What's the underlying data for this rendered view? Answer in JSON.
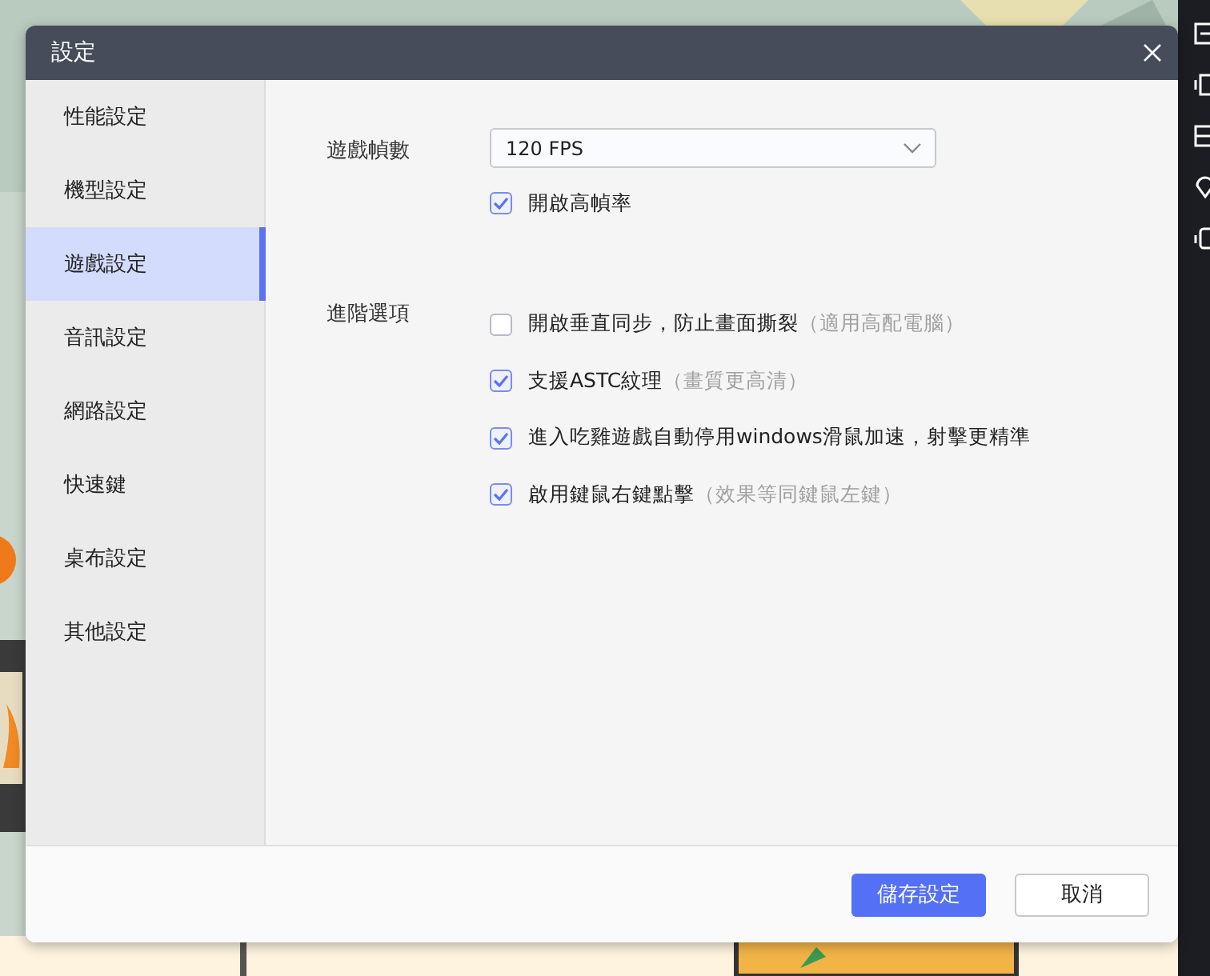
{
  "dialog": {
    "title": "設定"
  },
  "sidebar": {
    "items": [
      {
        "label": "性能設定",
        "selected": false
      },
      {
        "label": "機型設定",
        "selected": false
      },
      {
        "label": "遊戲設定",
        "selected": true
      },
      {
        "label": "音訊設定",
        "selected": false
      },
      {
        "label": "網路設定",
        "selected": false
      },
      {
        "label": "快速鍵",
        "selected": false
      },
      {
        "label": "桌布設定",
        "selected": false
      },
      {
        "label": "其他設定",
        "selected": false
      }
    ]
  },
  "frame_rate": {
    "label": "遊戲幀數",
    "value": "120 FPS",
    "option": {
      "label": "開啟高幀率",
      "checked": true
    }
  },
  "advanced": {
    "label": "進階選項",
    "options": [
      {
        "label": "開啟垂直同步，防止畫面撕裂",
        "note": "（適用高配電腦）",
        "checked": false
      },
      {
        "label": "支援ASTC紋理",
        "note": "（畫質更高清）",
        "checked": true
      },
      {
        "label": "進入吃雞遊戲自動停用windows滑鼠加速，射擊更精準",
        "checked": true
      },
      {
        "label": "啟用鍵鼠右鍵點擊",
        "note": "（效果等同鍵鼠左鍵）",
        "checked": true
      }
    ]
  },
  "buttons": {
    "save": "儲存設定",
    "cancel": "取消"
  }
}
